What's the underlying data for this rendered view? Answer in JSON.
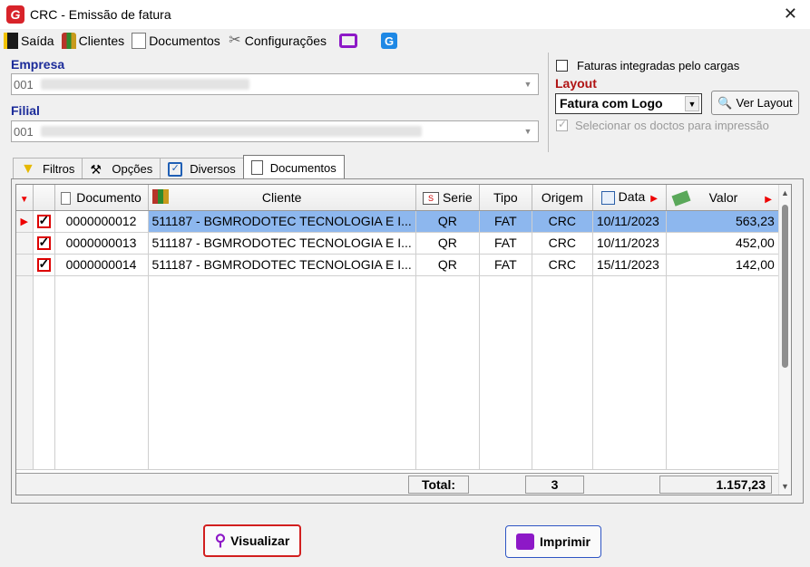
{
  "window": {
    "title": "CRC - Emissão de fatura",
    "app_logo": "G"
  },
  "menu": [
    {
      "label": "Saída",
      "icon": "exit-icon"
    },
    {
      "label": "Clientes",
      "icon": "clients-icon"
    },
    {
      "label": "Documentos",
      "icon": "documents-icon"
    },
    {
      "label": "Configurações",
      "icon": "settings-icon"
    }
  ],
  "empresa": {
    "label": "Empresa",
    "value": "001"
  },
  "filial": {
    "label": "Filial",
    "value": "001"
  },
  "options": {
    "faturas_integradas": "Faturas integradas pelo cargas",
    "layout_label": "Layout",
    "layout_value": "Fatura com Logo",
    "ver_layout": "Ver Layout",
    "selecionar_doctos": "Selecionar os doctos para impressão"
  },
  "tabs": [
    "Filtros",
    "Opções",
    "Diversos",
    "Documentos"
  ],
  "grid": {
    "columns": [
      "Documento",
      "Cliente",
      "Serie",
      "Tipo",
      "Origem",
      "Data",
      "Valor"
    ],
    "rows": [
      {
        "documento": "0000000012",
        "cliente": "511187 - BGMRODOTEC TECNOLOGIA E I...",
        "serie": "QR",
        "tipo": "FAT",
        "origem": "CRC",
        "data": "10/11/2023",
        "valor": "563,23"
      },
      {
        "documento": "0000000013",
        "cliente": "511187 - BGMRODOTEC TECNOLOGIA E I...",
        "serie": "QR",
        "tipo": "FAT",
        "origem": "CRC",
        "data": "10/11/2023",
        "valor": "452,00"
      },
      {
        "documento": "0000000014",
        "cliente": "511187 - BGMRODOTEC TECNOLOGIA E I...",
        "serie": "QR",
        "tipo": "FAT",
        "origem": "CRC",
        "data": "15/11/2023",
        "valor": "142,00"
      }
    ],
    "footer": {
      "total_label": "Total:",
      "count": "3",
      "sum": "1.157,23"
    }
  },
  "buttons": {
    "visualizar": "Visualizar",
    "imprimir": "Imprimir"
  },
  "colors": {
    "accent_blue": "#1c2c9a",
    "accent_red": "#b01313",
    "selection": "#8db7ee",
    "print_purple": "#8d18c7"
  }
}
